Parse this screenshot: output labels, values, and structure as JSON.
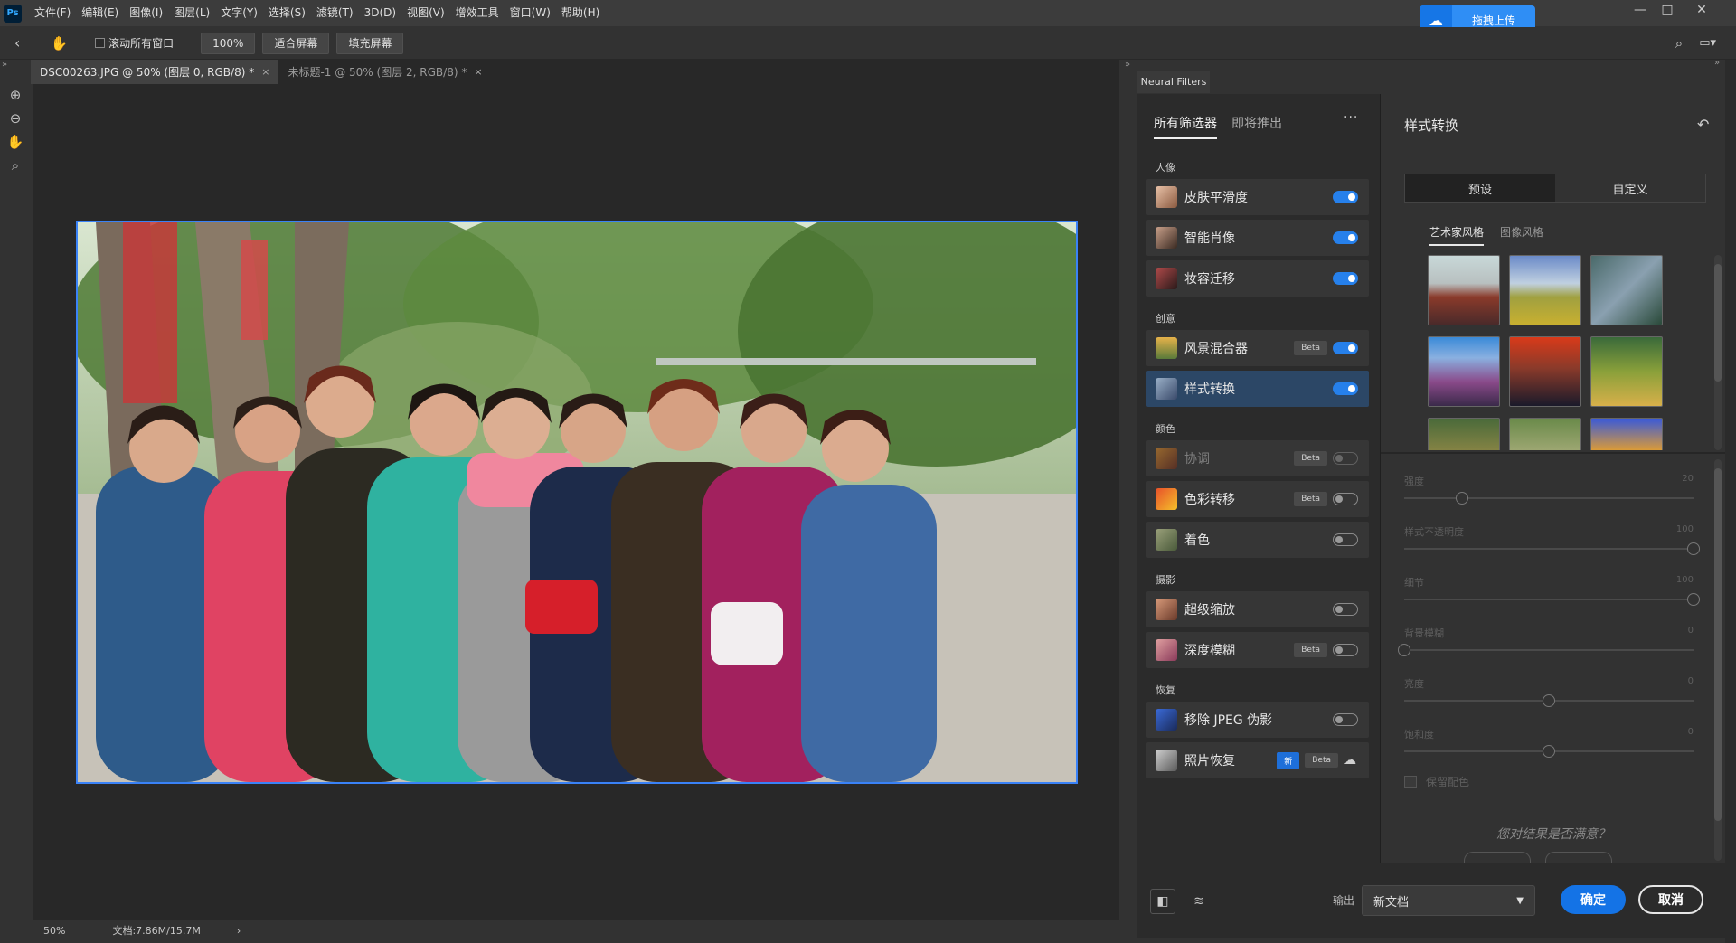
{
  "menubar": {
    "items": [
      "文件(F)",
      "编辑(E)",
      "图像(I)",
      "图层(L)",
      "文字(Y)",
      "选择(S)",
      "滤镜(T)",
      "3D(D)",
      "视图(V)",
      "增效工具",
      "窗口(W)",
      "帮助(H)"
    ],
    "upload_label": "拖拽上传",
    "logo": "Ps"
  },
  "options": {
    "scroll_all_label": "滚动所有窗口",
    "zoom_value": "100%",
    "fit_screen_label": "适合屏幕",
    "fill_screen_label": "填充屏幕"
  },
  "doc_tabs": [
    {
      "label": "DSC00263.JPG @ 50% (图层 0, RGB/8) *",
      "active": true
    },
    {
      "label": "未标题-1 @ 50% (图层 2, RGB/8) *",
      "active": false
    }
  ],
  "status": {
    "zoom": "50%",
    "doc": "文档:7.86M/15.7M",
    "arrow": "›"
  },
  "neural": {
    "panel_tab": "Neural Filters",
    "tabs": [
      "所有筛选器",
      "即将推出"
    ],
    "more": "···",
    "categories": {
      "portrait": "人像",
      "creative": "创意",
      "color": "颜色",
      "photo": "摄影",
      "restore": "恢复"
    },
    "filters": [
      {
        "name": "皮肤平滑度",
        "badge": "",
        "toggle": "on"
      },
      {
        "name": "智能肖像",
        "badge": "",
        "toggle": "on"
      },
      {
        "name": "妆容迁移",
        "badge": "",
        "toggle": "on"
      },
      {
        "name": "风景混合器",
        "badge": "Beta",
        "toggle": "on"
      },
      {
        "name": "样式转换",
        "badge": "",
        "toggle": "on"
      },
      {
        "name": "协调",
        "badge": "Beta",
        "toggle": "off"
      },
      {
        "name": "色彩转移",
        "badge": "Beta",
        "toggle": "off"
      },
      {
        "name": "着色",
        "badge": "",
        "toggle": "off"
      },
      {
        "name": "超级缩放",
        "badge": "",
        "toggle": "off"
      },
      {
        "name": "深度模糊",
        "badge": "Beta",
        "toggle": "off"
      },
      {
        "name": "移除 JPEG 伪影",
        "badge": "",
        "toggle": "off"
      },
      {
        "name": "照片恢复",
        "badge_new": "新",
        "badge": "Beta",
        "toggle": "cloud"
      }
    ],
    "detail": {
      "title": "样式转换",
      "seg": [
        "预设",
        "自定义"
      ],
      "subtabs": [
        "艺术家风格",
        "图像风格"
      ],
      "sliders": [
        {
          "label": "强度",
          "value": "20"
        },
        {
          "label": "样式不透明度",
          "value": "100"
        },
        {
          "label": "细节",
          "value": "100"
        },
        {
          "label": "背景模糊",
          "value": "0"
        },
        {
          "label": "亮度",
          "value": "0"
        },
        {
          "label": "饱和度",
          "value": "0"
        }
      ],
      "preserve_color": "保留配色",
      "satisfied": "您对结果是否满意？"
    },
    "output_label": "输出",
    "output_value": "新文档",
    "ok": "确定",
    "cancel": "取消"
  },
  "colors": {
    "accent": "#1473e6",
    "selected_row": "#2c4766",
    "toggle_on": "#2680eb"
  }
}
